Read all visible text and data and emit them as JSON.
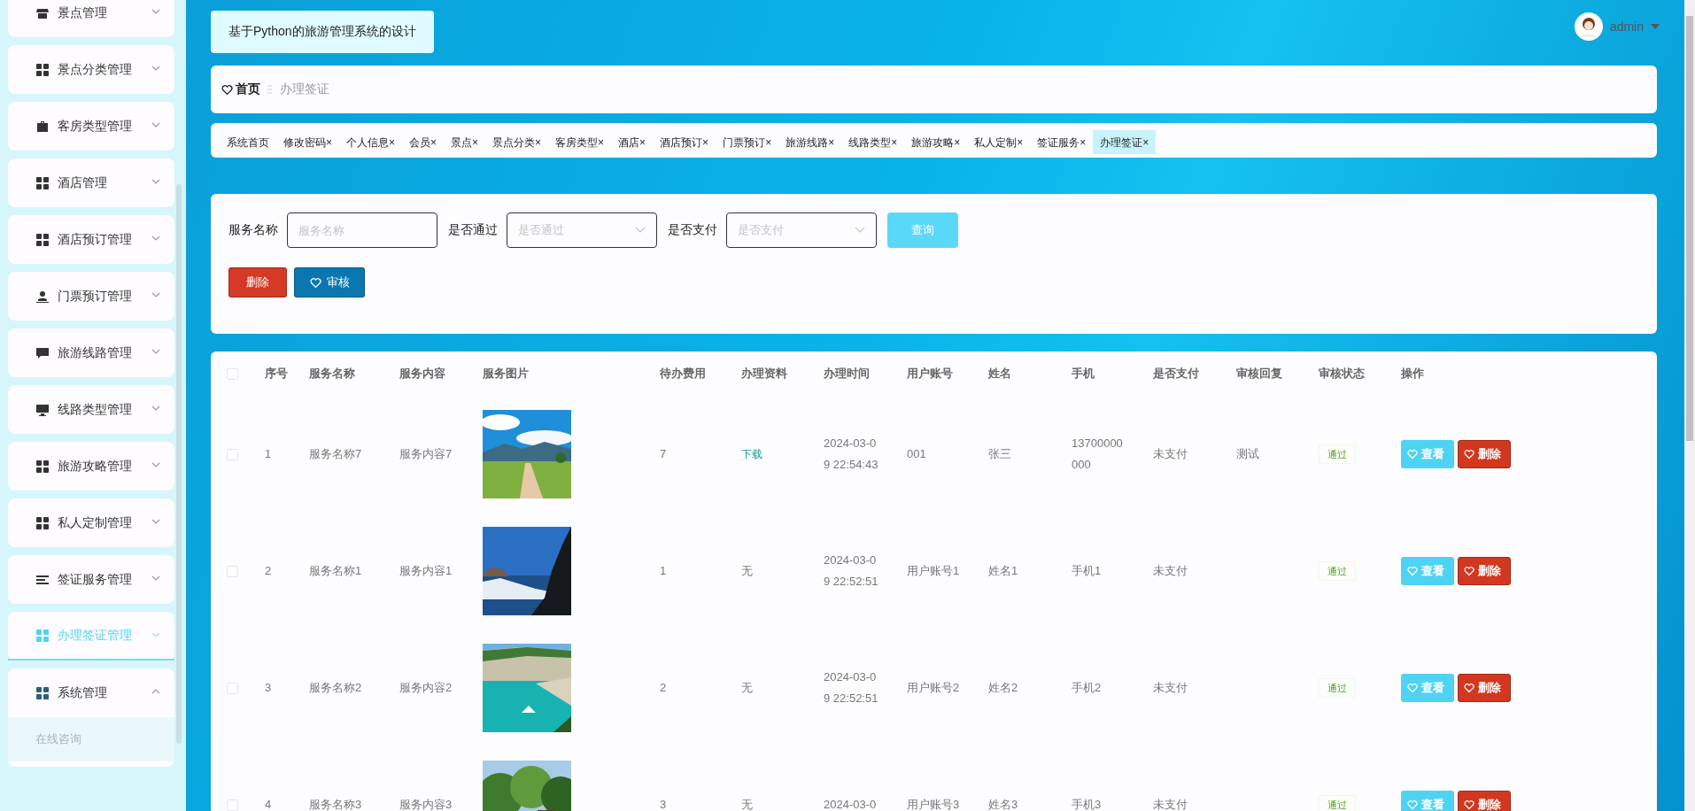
{
  "sidebar": {
    "items": [
      {
        "label": "景点管理",
        "selected": false,
        "expanded": false
      },
      {
        "label": "景点分类管理",
        "selected": false,
        "expanded": false
      },
      {
        "label": "客房类型管理",
        "selected": false,
        "expanded": false
      },
      {
        "label": "酒店管理",
        "selected": false,
        "expanded": false
      },
      {
        "label": "酒店预订管理",
        "selected": false,
        "expanded": false
      },
      {
        "label": "门票预订管理",
        "selected": false,
        "expanded": false
      },
      {
        "label": "旅游线路管理",
        "selected": false,
        "expanded": false
      },
      {
        "label": "线路类型管理",
        "selected": false,
        "expanded": false
      },
      {
        "label": "旅游攻略管理",
        "selected": false,
        "expanded": false
      },
      {
        "label": "私人定制管理",
        "selected": false,
        "expanded": false
      },
      {
        "label": "签证服务管理",
        "selected": false,
        "expanded": false
      },
      {
        "label": "办理签证管理",
        "selected": true,
        "expanded": false
      },
      {
        "label": "系统管理",
        "selected": false,
        "expanded": true,
        "children": [
          {
            "label": "在线咨询"
          }
        ]
      }
    ]
  },
  "header": {
    "title": "基于Python的旅游管理系统的设计",
    "user": "admin"
  },
  "breadcrumb": {
    "home": "首页",
    "current": "办理签证"
  },
  "tabs": [
    {
      "label": "系统首页",
      "selected": false
    },
    {
      "label": "修改密码",
      "close": "×",
      "selected": false
    },
    {
      "label": "个人信息",
      "close": "×",
      "selected": false
    },
    {
      "label": "会员",
      "close": "×",
      "selected": false
    },
    {
      "label": "景点",
      "close": "×",
      "selected": false
    },
    {
      "label": "景点分类",
      "close": "×",
      "selected": false
    },
    {
      "label": "客房类型",
      "close": "×",
      "selected": false
    },
    {
      "label": "酒店",
      "close": "×",
      "selected": false
    },
    {
      "label": "酒店预订",
      "close": "×",
      "selected": false
    },
    {
      "label": "门票预订",
      "close": "×",
      "selected": false
    },
    {
      "label": "旅游线路",
      "close": "×",
      "selected": false
    },
    {
      "label": "线路类型",
      "close": "×",
      "selected": false
    },
    {
      "label": "旅游攻略",
      "close": "×",
      "selected": false
    },
    {
      "label": "私人定制",
      "close": "×",
      "selected": false
    },
    {
      "label": "签证服务",
      "close": "×",
      "selected": false
    },
    {
      "label": "办理签证",
      "close": "×",
      "selected": true
    }
  ],
  "filters": [
    {
      "kind": "input",
      "label": "服务名称",
      "placeholder": "服务名称"
    },
    {
      "kind": "select",
      "label": "是否通过",
      "placeholder": "是否通过"
    },
    {
      "kind": "select",
      "label": "是否支付",
      "placeholder": "是否支付"
    }
  ],
  "search_button": "查询",
  "actions": [
    {
      "kind": "danger",
      "label": "删除"
    },
    {
      "kind": "primary",
      "label": "审核"
    }
  ],
  "table": {
    "select_all": {
      "checked": false
    },
    "columns": [
      "序号",
      "服务名称",
      "服务内容",
      "服务图片",
      "待办费用",
      "办理资料",
      "办理时间",
      "用户账号",
      "姓名",
      "手机",
      "是否支付",
      "审核回复",
      "审核状态",
      "操作"
    ],
    "rows": [
      {
        "checked": false,
        "index": "1",
        "name": "服务名称7",
        "content": "服务内容7",
        "fee": "7",
        "material": {
          "kind": "link",
          "text": "下载"
        },
        "time": "2024-03-09 22:54:43",
        "account": "001",
        "person": "张三",
        "phone": "13700000000",
        "paid": "未支付",
        "reply": "测试",
        "status": "通过",
        "view": "查看",
        "delete": "删除"
      },
      {
        "checked": false,
        "index": "2",
        "name": "服务名称1",
        "content": "服务内容1",
        "fee": "1",
        "material": {
          "kind": "text",
          "text": "无"
        },
        "time": "2024-03-09 22:52:51",
        "account": "用户账号1",
        "person": "姓名1",
        "phone": "手机1",
        "paid": "未支付",
        "status": "通过",
        "view": "查看",
        "delete": "删除"
      },
      {
        "checked": false,
        "index": "3",
        "name": "服务名称2",
        "content": "服务内容2",
        "fee": "2",
        "material": {
          "kind": "text",
          "text": "无"
        },
        "time": "2024-03-09 22:52:51",
        "account": "用户账号2",
        "person": "姓名2",
        "phone": "手机2",
        "paid": "未支付",
        "status": "通过",
        "view": "查看",
        "delete": "删除"
      },
      {
        "checked": false,
        "index": "4",
        "name": "服务名称3",
        "content": "服务内容3",
        "fee": "3",
        "material": {
          "kind": "text",
          "text": "无"
        },
        "time": "2024-03-0",
        "account": "用户账号3",
        "person": "姓名3",
        "phone": "手机3",
        "paid": "未支付",
        "status": "通过",
        "view": "查看",
        "delete": "删除"
      }
    ]
  }
}
